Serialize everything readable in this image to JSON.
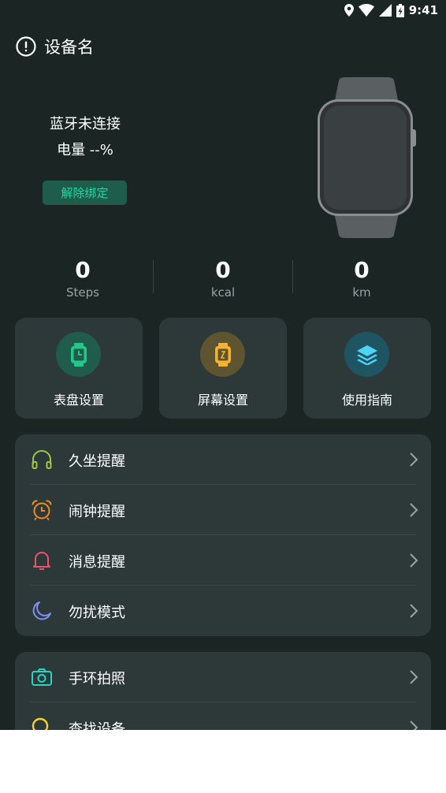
{
  "status_bar": {
    "time": "9:41"
  },
  "header": {
    "title": "设备名"
  },
  "device": {
    "connection_status": "蓝牙未连接",
    "battery": "电量 --%",
    "unbind_label": "解除绑定"
  },
  "stats": [
    {
      "value": "0",
      "label": "Steps"
    },
    {
      "value": "0",
      "label": "kcal"
    },
    {
      "value": "0",
      "label": "km"
    }
  ],
  "features": [
    {
      "label": "表盘设置",
      "icon": "watch-face-icon",
      "color": "#1ec98a",
      "bg": "#1f5c4c"
    },
    {
      "label": "屏幕设置",
      "icon": "screen-icon",
      "color": "#f5b32b",
      "bg": "#5f5430"
    },
    {
      "label": "使用指南",
      "icon": "layers-icon",
      "color": "#4fd3f5",
      "bg": "#1f5563"
    }
  ],
  "reminders": [
    {
      "label": "久坐提醒",
      "icon": "headphones-icon",
      "color": "#9cc83a"
    },
    {
      "label": "闹钟提醒",
      "icon": "alarm-clock-icon",
      "color": "#f08c1e"
    },
    {
      "label": "消息提醒",
      "icon": "bell-icon",
      "color": "#f0506e"
    },
    {
      "label": "勿扰模式",
      "icon": "moon-icon",
      "color": "#7f8ef0"
    }
  ],
  "tools": [
    {
      "label": "手环拍照",
      "icon": "camera-icon",
      "color": "#27d6c0"
    },
    {
      "label": "查找设备",
      "icon": "search-icon",
      "color": "#f5d22b"
    }
  ]
}
